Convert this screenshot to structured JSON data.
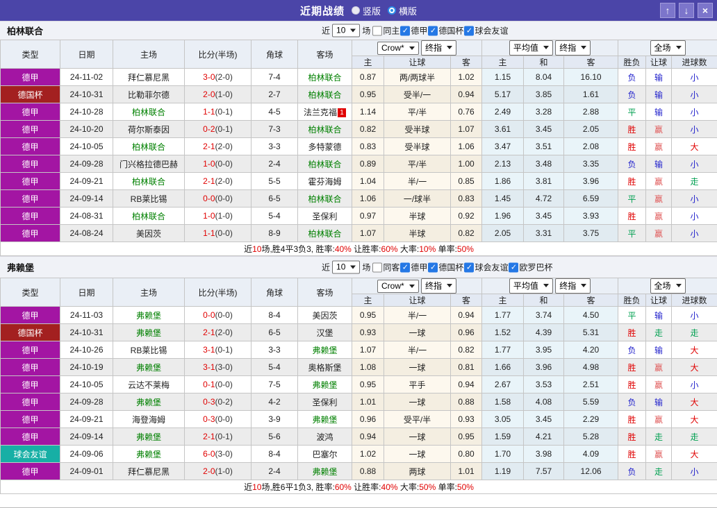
{
  "titlebar": {
    "title": "近期战绩",
    "vertical_label": "竖版",
    "horizontal_label": "横版",
    "up_icon": "↑",
    "down_icon": "↓",
    "close_icon": "×"
  },
  "columns": {
    "main": [
      "类型",
      "日期",
      "主场",
      "比分(半场)",
      "角球",
      "客场"
    ],
    "sub": [
      "主",
      "让球",
      "客",
      "主",
      "和",
      "客",
      "胜负",
      "让球",
      "进球数"
    ]
  },
  "colors": {
    "league": {
      "德甲": "#A315A3",
      "德国杯": "#A32020",
      "球会友谊": "#17AFA5"
    },
    "result": {
      "胜": "#E00000",
      "平": "#00A050",
      "负": "#2222CC",
      "赢": "#E05B5B",
      "输": "#2222CC",
      "走": "#00A050",
      "大": "#E00000",
      "小": "#2222CC"
    },
    "score": "#E00000",
    "self_team": "#008000"
  },
  "sections": [
    {
      "team": "柏林联合",
      "filter": {
        "prefix": "近",
        "count": "10",
        "suffix": "场",
        "venue": {
          "label": "同主",
          "checked": false
        },
        "leagues": [
          {
            "label": "德甲",
            "checked": true
          },
          {
            "label": "德国杯",
            "checked": true
          },
          {
            "label": "球会友谊",
            "checked": true
          }
        ]
      },
      "dropdowns": {
        "provider": "Crow*",
        "provider_final": "终指",
        "average": "平均值",
        "average_final": "终指",
        "scope": "全场"
      },
      "rows": [
        {
          "league": "德甲",
          "date": "24-11-02",
          "home": "拜仁慕尼黑",
          "home_self": false,
          "score": "3-0",
          "half": "(2-0)",
          "corners": "7-4",
          "away": "柏林联合",
          "away_self": true,
          "away_badge": "",
          "odds": [
            "0.87",
            "两/两球半",
            "1.02"
          ],
          "avg": [
            "1.15",
            "8.04",
            "16.10"
          ],
          "results": [
            "负",
            "输",
            "小"
          ]
        },
        {
          "league": "德国杯",
          "date": "24-10-31",
          "home": "比勒菲尔德",
          "home_self": false,
          "score": "2-0",
          "half": "(1-0)",
          "corners": "2-7",
          "away": "柏林联合",
          "away_self": true,
          "away_badge": "",
          "odds": [
            "0.95",
            "受半/一",
            "0.94"
          ],
          "avg": [
            "5.17",
            "3.85",
            "1.61"
          ],
          "results": [
            "负",
            "输",
            "小"
          ]
        },
        {
          "league": "德甲",
          "date": "24-10-28",
          "home": "柏林联合",
          "home_self": true,
          "score": "1-1",
          "half": "(0-1)",
          "corners": "4-5",
          "away": "法兰克福",
          "away_self": false,
          "away_badge": "1",
          "odds": [
            "1.14",
            "平/半",
            "0.76"
          ],
          "avg": [
            "2.49",
            "3.28",
            "2.88"
          ],
          "results": [
            "平",
            "输",
            "小"
          ]
        },
        {
          "league": "德甲",
          "date": "24-10-20",
          "home": "荷尔斯泰因",
          "home_self": false,
          "score": "0-2",
          "half": "(0-1)",
          "corners": "7-3",
          "away": "柏林联合",
          "away_self": true,
          "away_badge": "",
          "odds": [
            "0.82",
            "受半球",
            "1.07"
          ],
          "avg": [
            "3.61",
            "3.45",
            "2.05"
          ],
          "results": [
            "胜",
            "赢",
            "小"
          ]
        },
        {
          "league": "德甲",
          "date": "24-10-05",
          "home": "柏林联合",
          "home_self": true,
          "score": "2-1",
          "half": "(2-0)",
          "corners": "3-3",
          "away": "多特蒙德",
          "away_self": false,
          "away_badge": "",
          "odds": [
            "0.83",
            "受半球",
            "1.06"
          ],
          "avg": [
            "3.47",
            "3.51",
            "2.08"
          ],
          "results": [
            "胜",
            "赢",
            "大"
          ]
        },
        {
          "league": "德甲",
          "date": "24-09-28",
          "home": "门兴格拉德巴赫",
          "home_self": false,
          "score": "1-0",
          "half": "(0-0)",
          "corners": "2-4",
          "away": "柏林联合",
          "away_self": true,
          "away_badge": "",
          "odds": [
            "0.89",
            "平/半",
            "1.00"
          ],
          "avg": [
            "2.13",
            "3.48",
            "3.35"
          ],
          "results": [
            "负",
            "输",
            "小"
          ]
        },
        {
          "league": "德甲",
          "date": "24-09-21",
          "home": "柏林联合",
          "home_self": true,
          "score": "2-1",
          "half": "(2-0)",
          "corners": "5-5",
          "away": "霍芬海姆",
          "away_self": false,
          "away_badge": "",
          "odds": [
            "1.04",
            "半/一",
            "0.85"
          ],
          "avg": [
            "1.86",
            "3.81",
            "3.96"
          ],
          "results": [
            "胜",
            "赢",
            "走"
          ]
        },
        {
          "league": "德甲",
          "date": "24-09-14",
          "home": "RB莱比锡",
          "home_self": false,
          "score": "0-0",
          "half": "(0-0)",
          "corners": "6-5",
          "away": "柏林联合",
          "away_self": true,
          "away_badge": "",
          "odds": [
            "1.06",
            "一/球半",
            "0.83"
          ],
          "avg": [
            "1.45",
            "4.72",
            "6.59"
          ],
          "results": [
            "平",
            "赢",
            "小"
          ]
        },
        {
          "league": "德甲",
          "date": "24-08-31",
          "home": "柏林联合",
          "home_self": true,
          "score": "1-0",
          "half": "(1-0)",
          "corners": "5-4",
          "away": "圣保利",
          "away_self": false,
          "away_badge": "",
          "odds": [
            "0.97",
            "半球",
            "0.92"
          ],
          "avg": [
            "1.96",
            "3.45",
            "3.93"
          ],
          "results": [
            "胜",
            "赢",
            "小"
          ]
        },
        {
          "league": "德甲",
          "date": "24-08-24",
          "home": "美因茨",
          "home_self": false,
          "score": "1-1",
          "half": "(0-0)",
          "corners": "8-9",
          "away": "柏林联合",
          "away_self": true,
          "away_badge": "",
          "odds": [
            "1.07",
            "半球",
            "0.82"
          ],
          "avg": [
            "2.05",
            "3.31",
            "3.75"
          ],
          "results": [
            "平",
            "赢",
            "小"
          ]
        }
      ],
      "summary": [
        {
          "t": "近",
          "r": false
        },
        {
          "t": "10",
          "r": true
        },
        {
          "t": "场,胜4平3负3, 胜率:",
          "r": false
        },
        {
          "t": "40%",
          "r": true
        },
        {
          "t": " 让胜率:",
          "r": false
        },
        {
          "t": "60%",
          "r": true
        },
        {
          "t": " 大率:",
          "r": false
        },
        {
          "t": "10%",
          "r": true
        },
        {
          "t": " 单率:",
          "r": false
        },
        {
          "t": "50%",
          "r": true
        }
      ]
    },
    {
      "team": "弗赖堡",
      "filter": {
        "prefix": "近",
        "count": "10",
        "suffix": "场",
        "venue": {
          "label": "同客",
          "checked": false
        },
        "leagues": [
          {
            "label": "德甲",
            "checked": true
          },
          {
            "label": "德国杯",
            "checked": true
          },
          {
            "label": "球会友谊",
            "checked": true
          },
          {
            "label": "欧罗巴杯",
            "checked": true
          }
        ]
      },
      "dropdowns": {
        "provider": "Crow*",
        "provider_final": "终指",
        "average": "平均值",
        "average_final": "终指",
        "scope": "全场"
      },
      "rows": [
        {
          "league": "德甲",
          "date": "24-11-03",
          "home": "弗赖堡",
          "home_self": true,
          "score": "0-0",
          "half": "(0-0)",
          "corners": "8-4",
          "away": "美因茨",
          "away_self": false,
          "away_badge": "",
          "odds": [
            "0.95",
            "半/一",
            "0.94"
          ],
          "avg": [
            "1.77",
            "3.74",
            "4.50"
          ],
          "results": [
            "平",
            "输",
            "小"
          ]
        },
        {
          "league": "德国杯",
          "date": "24-10-31",
          "home": "弗赖堡",
          "home_self": true,
          "score": "2-1",
          "half": "(2-0)",
          "corners": "6-5",
          "away": "汉堡",
          "away_self": false,
          "away_badge": "",
          "odds": [
            "0.93",
            "一球",
            "0.96"
          ],
          "avg": [
            "1.52",
            "4.39",
            "5.31"
          ],
          "results": [
            "胜",
            "走",
            "走"
          ]
        },
        {
          "league": "德甲",
          "date": "24-10-26",
          "home": "RB莱比锡",
          "home_self": false,
          "score": "3-1",
          "half": "(0-1)",
          "corners": "3-3",
          "away": "弗赖堡",
          "away_self": true,
          "away_badge": "",
          "odds": [
            "1.07",
            "半/一",
            "0.82"
          ],
          "avg": [
            "1.77",
            "3.95",
            "4.20"
          ],
          "results": [
            "负",
            "输",
            "大"
          ]
        },
        {
          "league": "德甲",
          "date": "24-10-19",
          "home": "弗赖堡",
          "home_self": true,
          "score": "3-1",
          "half": "(3-0)",
          "corners": "5-4",
          "away": "奥格斯堡",
          "away_self": false,
          "away_badge": "",
          "odds": [
            "1.08",
            "一球",
            "0.81"
          ],
          "avg": [
            "1.66",
            "3.96",
            "4.98"
          ],
          "results": [
            "胜",
            "赢",
            "大"
          ]
        },
        {
          "league": "德甲",
          "date": "24-10-05",
          "home": "云达不莱梅",
          "home_self": false,
          "score": "0-1",
          "half": "(0-0)",
          "corners": "7-5",
          "away": "弗赖堡",
          "away_self": true,
          "away_badge": "",
          "odds": [
            "0.95",
            "平手",
            "0.94"
          ],
          "avg": [
            "2.67",
            "3.53",
            "2.51"
          ],
          "results": [
            "胜",
            "赢",
            "小"
          ]
        },
        {
          "league": "德甲",
          "date": "24-09-28",
          "home": "弗赖堡",
          "home_self": true,
          "score": "0-3",
          "half": "(0-2)",
          "corners": "4-2",
          "away": "圣保利",
          "away_self": false,
          "away_badge": "",
          "odds": [
            "1.01",
            "一球",
            "0.88"
          ],
          "avg": [
            "1.58",
            "4.08",
            "5.59"
          ],
          "results": [
            "负",
            "输",
            "大"
          ]
        },
        {
          "league": "德甲",
          "date": "24-09-21",
          "home": "海登海姆",
          "home_self": false,
          "score": "0-3",
          "half": "(0-0)",
          "corners": "3-9",
          "away": "弗赖堡",
          "away_self": true,
          "away_badge": "",
          "odds": [
            "0.96",
            "受平/半",
            "0.93"
          ],
          "avg": [
            "3.05",
            "3.45",
            "2.29"
          ],
          "results": [
            "胜",
            "赢",
            "大"
          ]
        },
        {
          "league": "德甲",
          "date": "24-09-14",
          "home": "弗赖堡",
          "home_self": true,
          "score": "2-1",
          "half": "(0-1)",
          "corners": "5-6",
          "away": "波鸿",
          "away_self": false,
          "away_badge": "",
          "odds": [
            "0.94",
            "一球",
            "0.95"
          ],
          "avg": [
            "1.59",
            "4.21",
            "5.28"
          ],
          "results": [
            "胜",
            "走",
            "走"
          ]
        },
        {
          "league": "球会友谊",
          "date": "24-09-06",
          "home": "弗赖堡",
          "home_self": true,
          "score": "6-0",
          "half": "(3-0)",
          "corners": "8-4",
          "away": "巴塞尔",
          "away_self": false,
          "away_badge": "",
          "odds": [
            "1.02",
            "一球",
            "0.80"
          ],
          "avg": [
            "1.70",
            "3.98",
            "4.09"
          ],
          "results": [
            "胜",
            "赢",
            "大"
          ]
        },
        {
          "league": "德甲",
          "date": "24-09-01",
          "home": "拜仁慕尼黑",
          "home_self": false,
          "score": "2-0",
          "half": "(1-0)",
          "corners": "2-4",
          "away": "弗赖堡",
          "away_self": true,
          "away_badge": "",
          "odds": [
            "0.88",
            "两球",
            "1.01"
          ],
          "avg": [
            "1.19",
            "7.57",
            "12.06"
          ],
          "results": [
            "负",
            "走",
            "小"
          ]
        }
      ],
      "summary": [
        {
          "t": "近",
          "r": false
        },
        {
          "t": "10",
          "r": true
        },
        {
          "t": "场,胜6平1负3, 胜率:",
          "r": false
        },
        {
          "t": "60%",
          "r": true
        },
        {
          "t": " 让胜率:",
          "r": false
        },
        {
          "t": "40%",
          "r": true
        },
        {
          "t": " 大率:",
          "r": false
        },
        {
          "t": "50%",
          "r": true
        },
        {
          "t": " 单率:",
          "r": false
        },
        {
          "t": "50%",
          "r": true
        }
      ]
    }
  ]
}
